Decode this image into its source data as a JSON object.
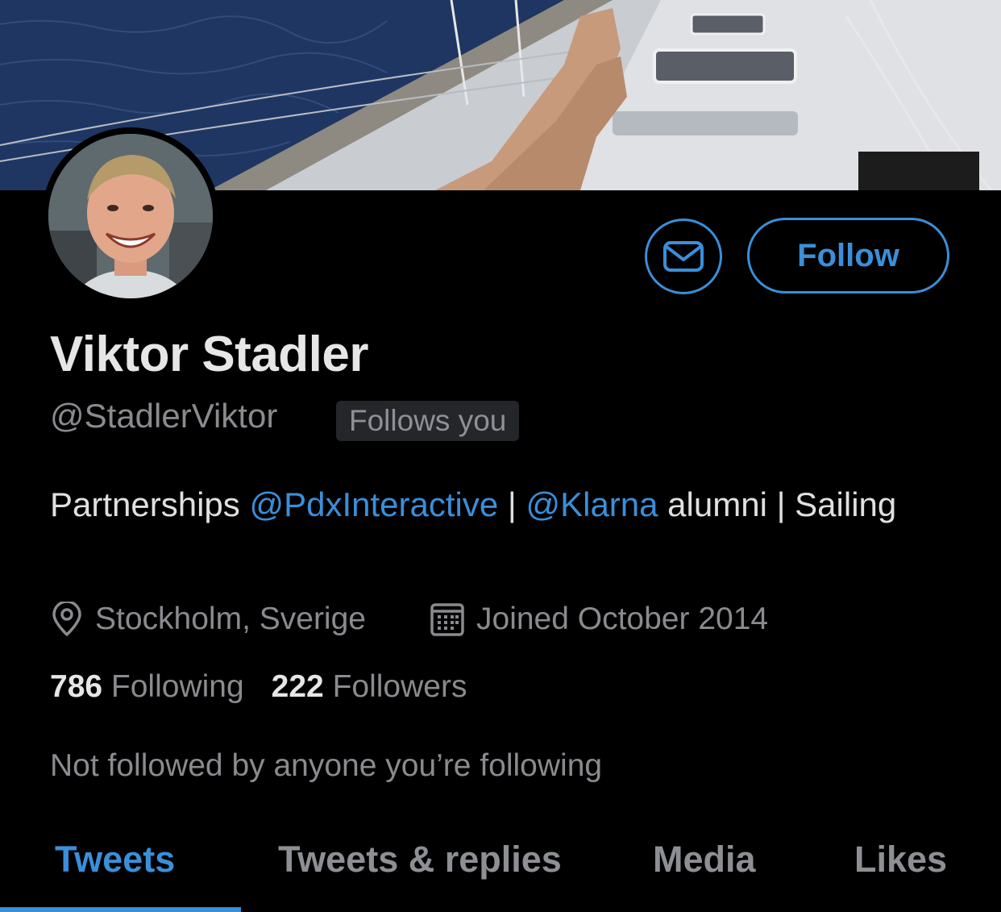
{
  "profile": {
    "name": "Viktor Stadler",
    "handle": "@StadlerViktor",
    "follows_you_badge": "Follows you",
    "bio": {
      "text1": "Partnerships ",
      "mention1": "@PdxInteractive",
      "text2": " | ",
      "mention2": "@Klarna",
      "text3": " alumni | Sailing"
    },
    "location": "Stockholm, Sverige",
    "joined": "Joined October 2014",
    "following_count": "786",
    "following_label": "Following",
    "followers_count": "222",
    "followers_label": "Followers",
    "mutuals_note": "Not followed by anyone you’re following"
  },
  "actions": {
    "follow_label": "Follow"
  },
  "tabs": [
    {
      "label": "Tweets",
      "active": true
    },
    {
      "label": "Tweets & replies",
      "active": false
    },
    {
      "label": "Media",
      "active": false
    },
    {
      "label": "Likes",
      "active": false
    }
  ],
  "colors": {
    "accent": "#3a8fd9",
    "background": "#000000",
    "secondary_text": "#8a8a8f"
  }
}
